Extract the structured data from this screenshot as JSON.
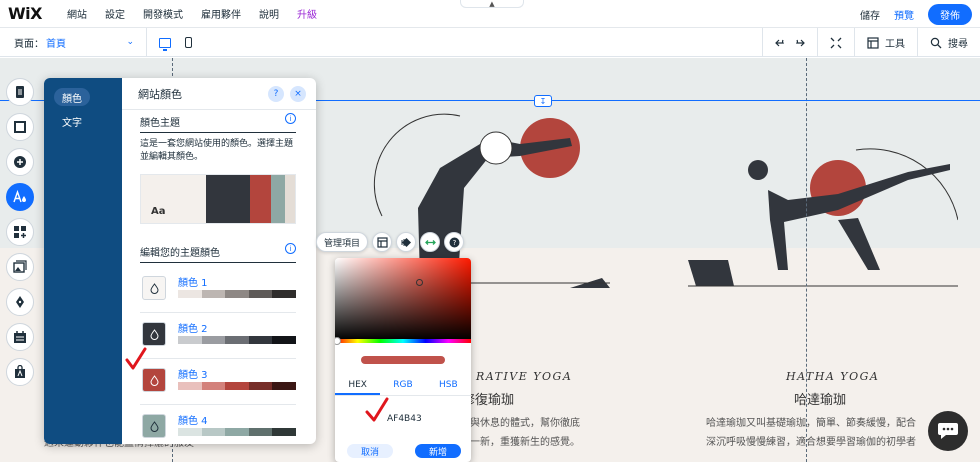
{
  "topbar": {
    "logo": "WiX",
    "menu": [
      "網站",
      "設定",
      "開發模式",
      "雇用夥伴",
      "說明",
      "升級"
    ],
    "save": "儲存",
    "preview": "預覽",
    "publish": "發佈"
  },
  "subbar": {
    "page_label": "頁面：",
    "page_value": "首頁",
    "tools_label": "工具",
    "search_label": "搜尋"
  },
  "site": {
    "left_title": "RATIVE YOGA",
    "left_zh": "修復瑜珈",
    "left_desc": [
      "簡單與休息的體式，幫你徹底",
      "煥然一新，重獲新生的感覺。"
    ],
    "right_title": "HATHA YOGA",
    "right_zh": "哈達瑜珈",
    "right_desc": [
      "哈達瑜珈又叫基礎瑜珈，簡單、節奏緩慢，配合",
      "深沉呼吸慢慢練習，適合想要學習瑜伽的初學者"
    ],
    "bottom_left": "適未運動夥伴也能盡情揮灑的服友"
  },
  "panel": {
    "tabs": [
      "顏色",
      "文字"
    ],
    "title": "網站顏色",
    "help": "?",
    "close": "×",
    "theme_heading": "顏色主題",
    "theme_desc": "這是一套您網站使用的顏色。選擇主題並編輯其顏色。",
    "theme_aa": "Aa",
    "theme_colors": [
      "#32363d",
      "#b3453d",
      "#8ea8a4",
      "#e4ddd6"
    ],
    "edit_heading": "編輯您的主題顏色",
    "colors": [
      {
        "name": "顏色 1",
        "swatch": "#f7f5f3",
        "shades": [
          "#ece6e2",
          "#bdb6b2",
          "#8e8885",
          "#5f5b59",
          "#2f2d2c"
        ]
      },
      {
        "name": "顏色 2",
        "swatch": "#32363d",
        "shades": [
          "#c9cbce",
          "#9a9ca1",
          "#6b6e73",
          "#32363d",
          "#121418"
        ]
      },
      {
        "name": "顏色 3",
        "swatch": "#b3453d",
        "shades": [
          "#e9c0bc",
          "#d3817b",
          "#b3453d",
          "#772e29",
          "#3b1714"
        ]
      },
      {
        "name": "顏色 4",
        "swatch": "#8ea8a4",
        "shades": [
          "#dbe4e2",
          "#b8c8c6",
          "#8ea8a4",
          "#5f706d",
          "#2f3837"
        ]
      }
    ]
  },
  "toolbar": {
    "manage": "管理項目"
  },
  "picker": {
    "tabs": [
      "HEX",
      "RGB",
      "HSB"
    ],
    "hex": "AF4B43",
    "preview_color": "#c0524b",
    "cancel": "取消",
    "add": "新增"
  },
  "colors": {
    "accent": "#116dff",
    "panel_side": "#0f4c81",
    "check": "#e0161d"
  }
}
